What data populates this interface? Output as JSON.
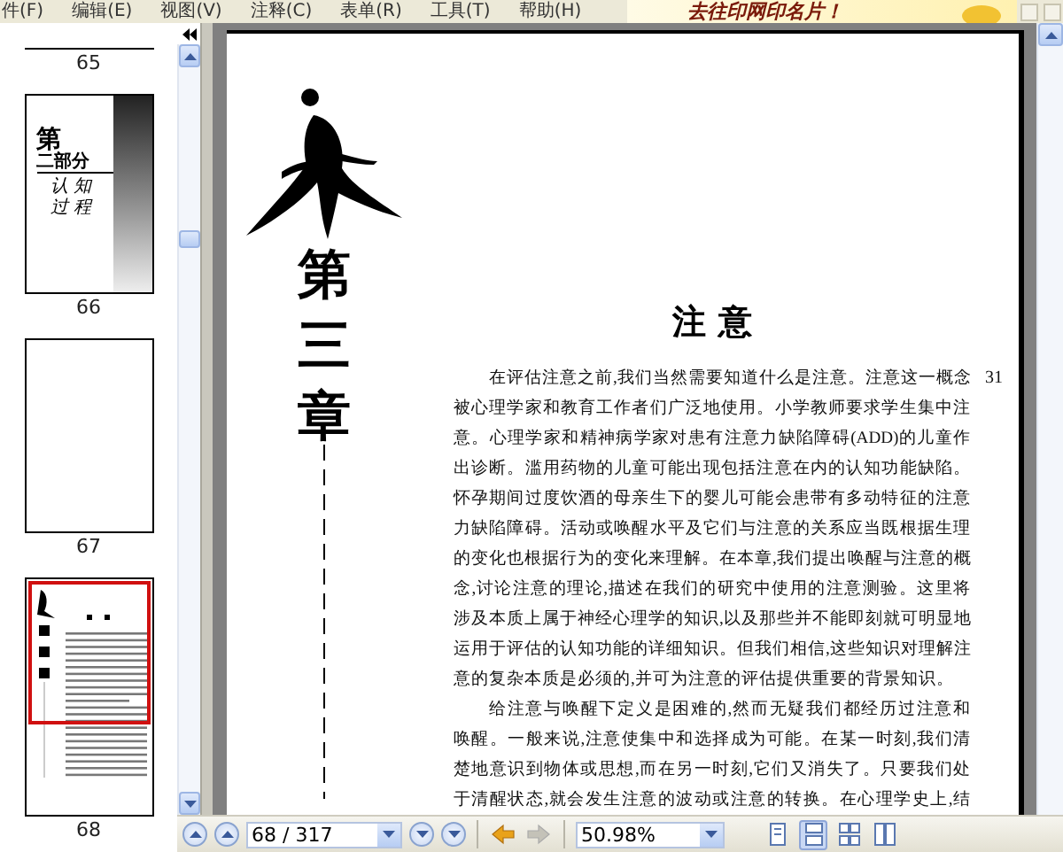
{
  "menu": [
    {
      "label": "件(F)"
    },
    {
      "label": "编辑(E)"
    },
    {
      "label": "视图(V)"
    },
    {
      "label": "注释(C)"
    },
    {
      "label": "表单(R)"
    },
    {
      "label": "工具(T)"
    },
    {
      "label": "帮助(H)"
    }
  ],
  "ad": {
    "text": "去往印网印名片！"
  },
  "thumbnails": [
    {
      "page": "65",
      "selected": false,
      "kind": "tail"
    },
    {
      "page": "66",
      "selected": false,
      "kind": "part_title",
      "texts": [
        "第",
        "二部分",
        "认 知",
        "过 程"
      ]
    },
    {
      "page": "67",
      "selected": false,
      "kind": "blank"
    },
    {
      "page": "68",
      "selected": true,
      "kind": "chapter"
    }
  ],
  "document": {
    "chapter_chars": [
      "第",
      "三",
      "章"
    ],
    "title": "注 意",
    "page_number": "31",
    "paragraphs": [
      {
        "continues": false,
        "lines": [
          "在评估注意之前,我们当然需要知道什么是注意。注意这一概念",
          "被心理学家和教育工作者们广泛地使用。小学教师要求学生集中注",
          "意。心理学家和精神病学家对患有注意力缺陷障碍(ADD)的儿童作",
          "出诊断。滥用药物的儿童可能出现包括注意在内的认知功能缺陷。",
          "怀孕期间过度饮酒的母亲生下的婴儿可能会患带有多动特征的注意",
          "力缺陷障碍。活动或唤醒水平及它们与注意的关系应当既根据生理",
          "的变化也根据行为的变化来理解。在本章,我们提出唤醒与注意的概",
          "念,讨论注意的理论,描述在我们的研究中使用的注意测验。这里将",
          "涉及本质上属于神经心理学的知识,以及那些并不能即刻就可明显地",
          "运用于评估的认知功能的详细知识。但我们相信,这些知识对理解注",
          "意的复杂本质是必须的,并可为注意的评估提供重要的背景知识。"
        ]
      },
      {
        "continues": true,
        "lines": [
          "给注意与唤醒下定义是困难的,然而无疑我们都经历过注意和",
          "唤醒。一般来说,注意使集中和选择成为可能。在某一时刻,我们清",
          "楚地意识到物体或思想,而在另一时刻,它们又消失了。只要我们处",
          "于清醒状态,就会发生注意的波动或注意的转换。在心理学史上,结"
        ]
      }
    ]
  },
  "toolbar": {
    "page_field": "68 / 317",
    "zoom_field": "50.98%",
    "history": [
      {
        "kind": "back",
        "disabled": false
      },
      {
        "kind": "forward",
        "disabled": true
      }
    ],
    "view_modes": [
      {
        "kind": "single",
        "selected": false
      },
      {
        "kind": "continuous",
        "selected": true
      },
      {
        "kind": "facing",
        "selected": false
      },
      {
        "kind": "continuous_facing",
        "selected": false
      }
    ]
  }
}
